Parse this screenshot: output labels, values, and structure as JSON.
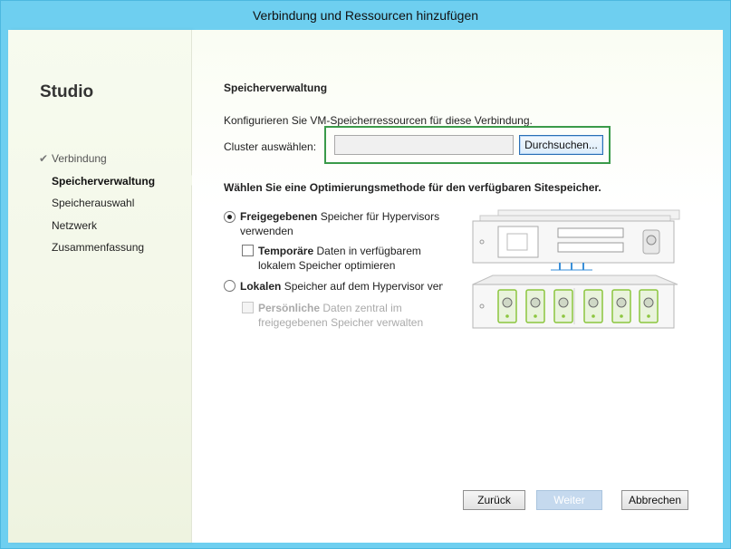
{
  "window": {
    "title": "Verbindung und Ressourcen hinzufügen"
  },
  "sidebar": {
    "app_name": "Studio",
    "steps": [
      {
        "label": "Verbindung",
        "state": "done"
      },
      {
        "label": "Speicherverwaltung",
        "state": "active"
      },
      {
        "label": "Speicherauswahl",
        "state": "pending"
      },
      {
        "label": "Netzwerk",
        "state": "pending"
      },
      {
        "label": "Zusammenfassung",
        "state": "pending"
      }
    ]
  },
  "main": {
    "heading": "Speicherverwaltung",
    "description": "Konfigurieren Sie VM-Speicherressourcen für diese Verbindung.",
    "cluster": {
      "label": "Cluster auswählen:",
      "value": "",
      "browse_label": "Durchsuchen..."
    },
    "optimization_heading": "Wählen Sie eine Optimierungsmethode für den verfügbaren Sitespeicher.",
    "options": {
      "shared": {
        "bold": "Freigegebenen",
        "rest_line1": " Speicher für Hypervisors",
        "line2": "verwenden",
        "checked": true
      },
      "temp": {
        "bold": "Temporäre",
        "rest_line1": " Daten in verfügbarem",
        "line2": "lokalem Speicher optimieren",
        "checked": false
      },
      "local": {
        "bold": "Lokalen",
        "rest_line1": " Speicher auf dem Hypervisor verwenden",
        "checked": false
      },
      "personal": {
        "bold": "Persönliche",
        "rest_line1": " Daten zentral im",
        "line2": "freigegebenen Speicher verwalten",
        "checked": false,
        "disabled": true
      }
    }
  },
  "footer": {
    "back_label": "Zurück",
    "next_label": "Weiter",
    "cancel_label": "Abbrechen"
  },
  "colors": {
    "titlebar": "#6ecff0",
    "highlight": "#3a9a4a",
    "accent": "#2b6fb5",
    "drive_green": "#8cc63f"
  }
}
